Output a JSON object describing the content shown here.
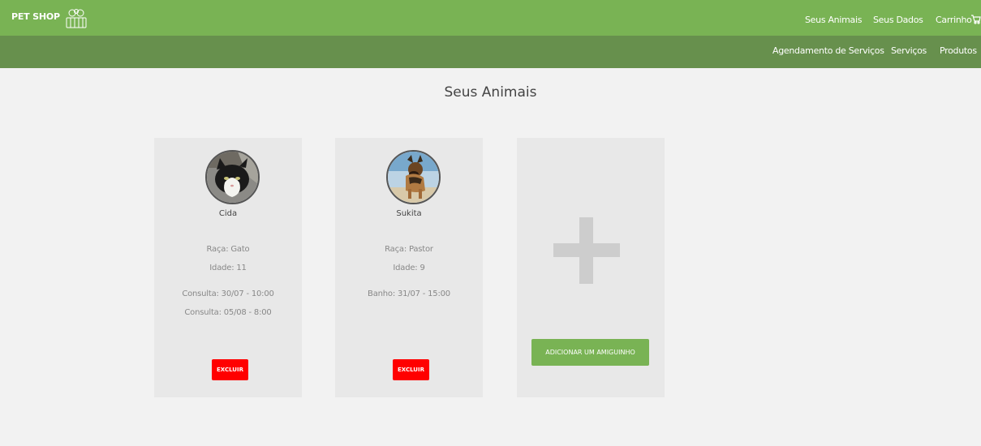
{
  "header": {
    "brand": "PET SHOP",
    "nav": [
      "Seus Animais",
      "Seus Dados",
      "Carrinho"
    ],
    "subnav": [
      "Agendamento de Serviços",
      "Serviços",
      "Produtos"
    ]
  },
  "page": {
    "title": "Seus Animais"
  },
  "pets": [
    {
      "name": "Cida",
      "raca": "Raça: Gato",
      "idade": "Idade: 11",
      "appointments": [
        "Consulta: 30/07 - 10:00",
        "Consulta: 05/08 - 8:00"
      ],
      "delete_label": "EXCLUIR"
    },
    {
      "name": "Sukita",
      "raca": "Raça: Pastor",
      "idade": "Idade: 9",
      "appointments": [
        "Banho: 31/07 - 15:00"
      ],
      "delete_label": "EXCLUIR"
    }
  ],
  "add_card": {
    "button_label": "ADICIONAR UM AMIGUINHO"
  },
  "colors": {
    "header": "#79b354",
    "subheader": "#67904d",
    "delete": "#ff0000",
    "add": "#79b354"
  }
}
